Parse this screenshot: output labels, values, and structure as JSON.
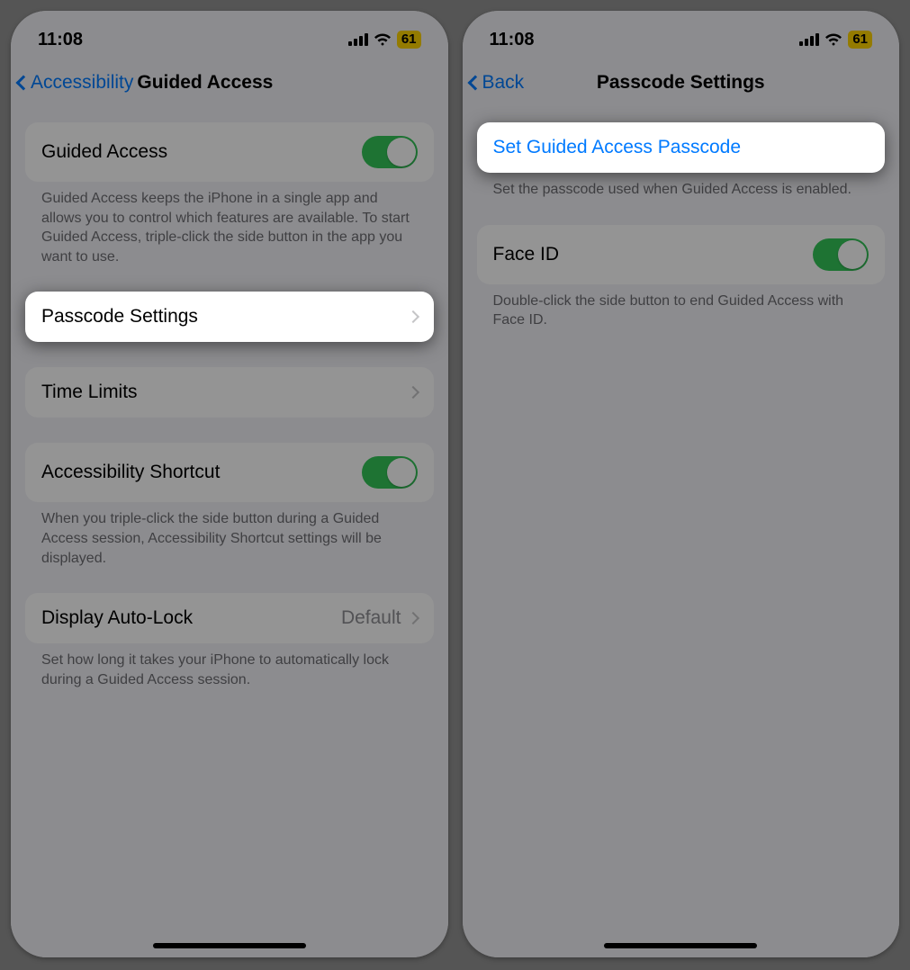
{
  "status": {
    "time": "11:08",
    "battery": "61"
  },
  "left": {
    "back": "Accessibility",
    "title": "Guided Access",
    "guided_toggle_label": "Guided Access",
    "guided_footer": "Guided Access keeps the iPhone in a single app and allows you to control which features are available. To start Guided Access, triple-click the side button in the app you want to use.",
    "passcode_label": "Passcode Settings",
    "time_limits_label": "Time Limits",
    "shortcut_label": "Accessibility Shortcut",
    "shortcut_footer": "When you triple-click the side button during a Guided Access session, Accessibility Shortcut settings will be displayed.",
    "autolock_label": "Display Auto-Lock",
    "autolock_value": "Default",
    "autolock_footer": "Set how long it takes your iPhone to automatically lock during a Guided Access session."
  },
  "right": {
    "back": "Back",
    "title": "Passcode Settings",
    "set_passcode_label": "Set Guided Access Passcode",
    "set_passcode_footer": "Set the passcode used when Guided Access is enabled.",
    "faceid_label": "Face ID",
    "faceid_footer": "Double-click the side button to end Guided Access with Face ID."
  }
}
